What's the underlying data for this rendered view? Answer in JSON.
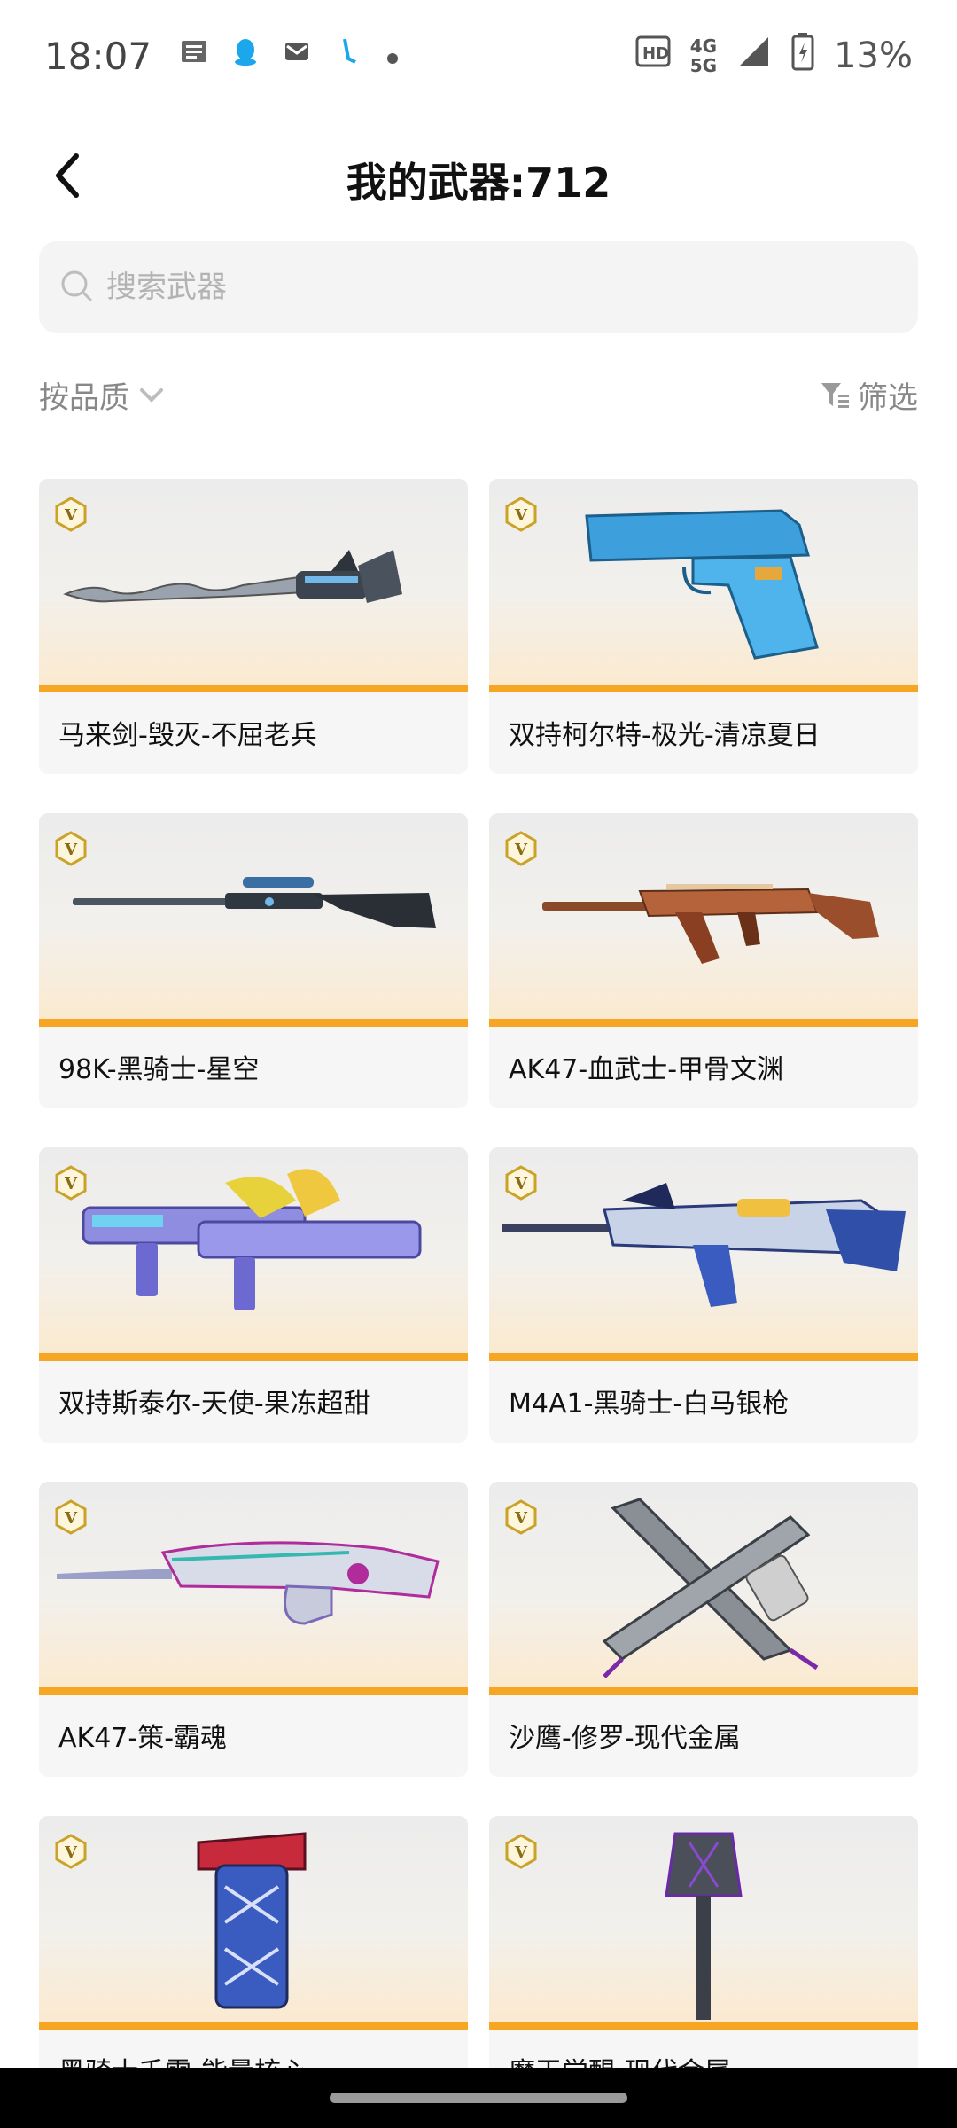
{
  "status_bar": {
    "time": "18:07",
    "network_top": "4G",
    "network_bottom": "5G",
    "battery": "13%",
    "icons": [
      "news-icon",
      "qq-penguin-icon",
      "mail-icon",
      "app-icon",
      "dot-icon",
      "hd-icon",
      "signal-icon",
      "battery-icon"
    ]
  },
  "header": {
    "title": "我的武器:712"
  },
  "search": {
    "placeholder": "搜索武器",
    "value": ""
  },
  "filters": {
    "sort_label": "按品质",
    "filter_label": "筛选"
  },
  "colors": {
    "accent": "#f6a623",
    "card_bg": "#f6f6f6",
    "badge_gold": "#c9a227"
  },
  "weapons": [
    {
      "name": "马来剑-毁灭-不屈老兵",
      "badge": "V"
    },
    {
      "name": "双持柯尔特-极光-清凉夏日",
      "badge": "V"
    },
    {
      "name": "98K-黑骑士-星空",
      "badge": "V"
    },
    {
      "name": "AK47-血武士-甲骨文渊",
      "badge": "V"
    },
    {
      "name": "双持斯泰尔-天使-果冻超甜",
      "badge": "V"
    },
    {
      "name": "M4A1-黑骑士-白马银枪",
      "badge": "V"
    },
    {
      "name": "AK47-策-霸魂",
      "badge": "V"
    },
    {
      "name": "沙鹰-修罗-现代金属",
      "badge": "V"
    },
    {
      "name": "黑骑士千雷-能量核心",
      "badge": "V"
    },
    {
      "name": "魔王觉醒-现代金属",
      "badge": "V"
    }
  ]
}
